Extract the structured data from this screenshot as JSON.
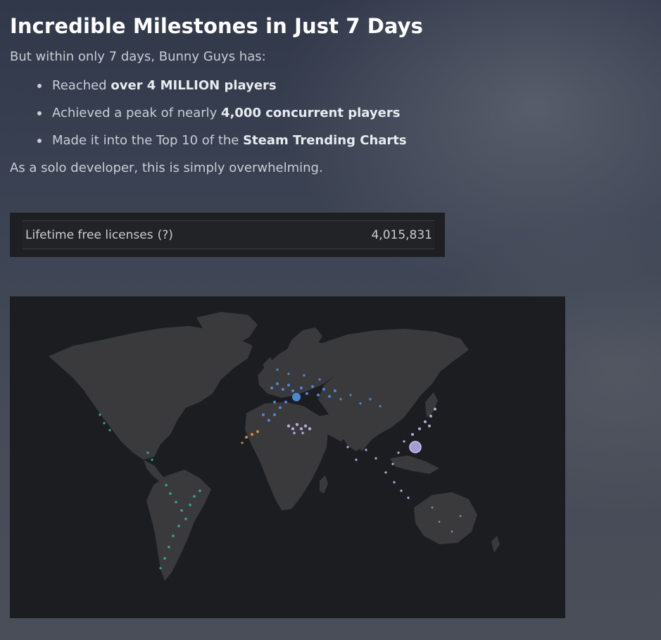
{
  "article": {
    "title": "Incredible Milestones in Just 7 Days",
    "intro": "But within only 7 days, Bunny Guys has:",
    "bullets": [
      {
        "prefix": "Reached ",
        "bold": "over 4 MILLION players",
        "suffix": ""
      },
      {
        "prefix": "Achieved a peak of nearly ",
        "bold": "4,000 concurrent players",
        "suffix": ""
      },
      {
        "prefix": "Made it into the Top 10 of the ",
        "bold": "Steam Trending Charts",
        "suffix": ""
      }
    ],
    "outro": "As a solo developer, this is simply overwhelming."
  },
  "stats": {
    "label": "Lifetime free licenses",
    "help": "(?)",
    "value": "4,015,831"
  },
  "map": {
    "icon": "world-map-icon",
    "colors": {
      "land": "#3a3a3c",
      "background": "#1c1d21",
      "europe": "#4f86d8",
      "americas": "#2fae8a",
      "asia": "#b6a9d8",
      "africa": "#d8893a"
    }
  }
}
